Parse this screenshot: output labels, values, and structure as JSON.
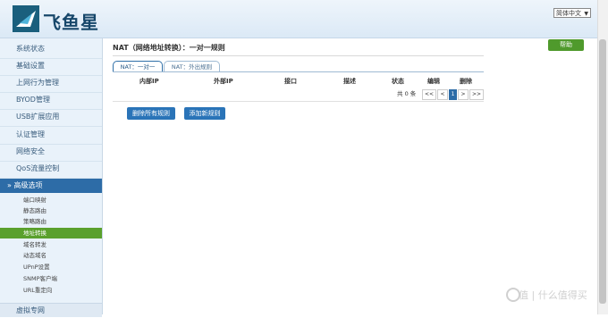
{
  "header": {
    "brand": "飞鱼星",
    "language": "简体中文"
  },
  "sidebar": {
    "items": [
      {
        "label": "系统状态"
      },
      {
        "label": "基础设置"
      },
      {
        "label": "上网行为管理"
      },
      {
        "label": "BYOD管理"
      },
      {
        "label": "USB扩展应用"
      },
      {
        "label": "认证管理"
      },
      {
        "label": "网络安全"
      },
      {
        "label": "QoS流量控制"
      }
    ],
    "section": "高级选项",
    "sub_items": [
      {
        "label": "端口映射",
        "active": false
      },
      {
        "label": "静态路由",
        "active": false
      },
      {
        "label": "策略路由",
        "active": false
      },
      {
        "label": "地址转换",
        "active": true
      },
      {
        "label": "域名转发",
        "active": false
      },
      {
        "label": "动态域名",
        "active": false
      },
      {
        "label": "UPnP设置",
        "active": false
      },
      {
        "label": "SNMP客户端",
        "active": false
      },
      {
        "label": "URL重定向",
        "active": false
      }
    ],
    "bottom": "虚拟专网"
  },
  "main": {
    "title": "NAT（网络地址转换）：一对一规则",
    "help": "帮助",
    "tabs": [
      {
        "label": "NAT：一对一",
        "active": true
      },
      {
        "label": "NAT：外出规则",
        "active": false
      }
    ],
    "columns": [
      "内部IP",
      "外部IP",
      "接口",
      "描述",
      "状态",
      "编辑",
      "删除"
    ],
    "pager": {
      "total": "共 0 条",
      "first": "<<",
      "prev": "<",
      "page": "1",
      "next": ">",
      "last": ">>"
    },
    "buttons": {
      "delete_all": "删除所有规则",
      "add_new": "添加新规则"
    }
  },
  "watermark": "值 | 什么值得买",
  "colors": {
    "primary": "#2d6ca7",
    "accent": "#5aa02c"
  }
}
